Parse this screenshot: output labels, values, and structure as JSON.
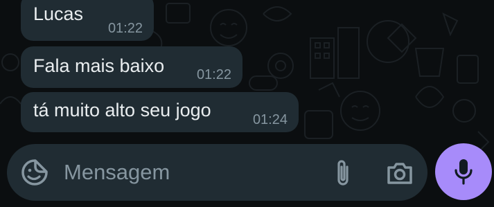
{
  "messages": [
    {
      "text": "Lucas",
      "time": "01:22"
    },
    {
      "text": "Fala mais baixo",
      "time": "01:22"
    },
    {
      "text": "tá muito alto seu jogo",
      "time": "01:24"
    }
  ],
  "composer": {
    "placeholder": "Mensagem",
    "icons": {
      "emoji": "sticker-emoji-icon",
      "attach": "paperclip-icon",
      "camera": "camera-icon",
      "mic": "microphone-icon"
    }
  },
  "colors": {
    "background": "#0b0e10",
    "bubble": "#202c33",
    "text": "#e9edef",
    "timestamp": "#8696a0",
    "mic_button": "#a78bfa"
  }
}
